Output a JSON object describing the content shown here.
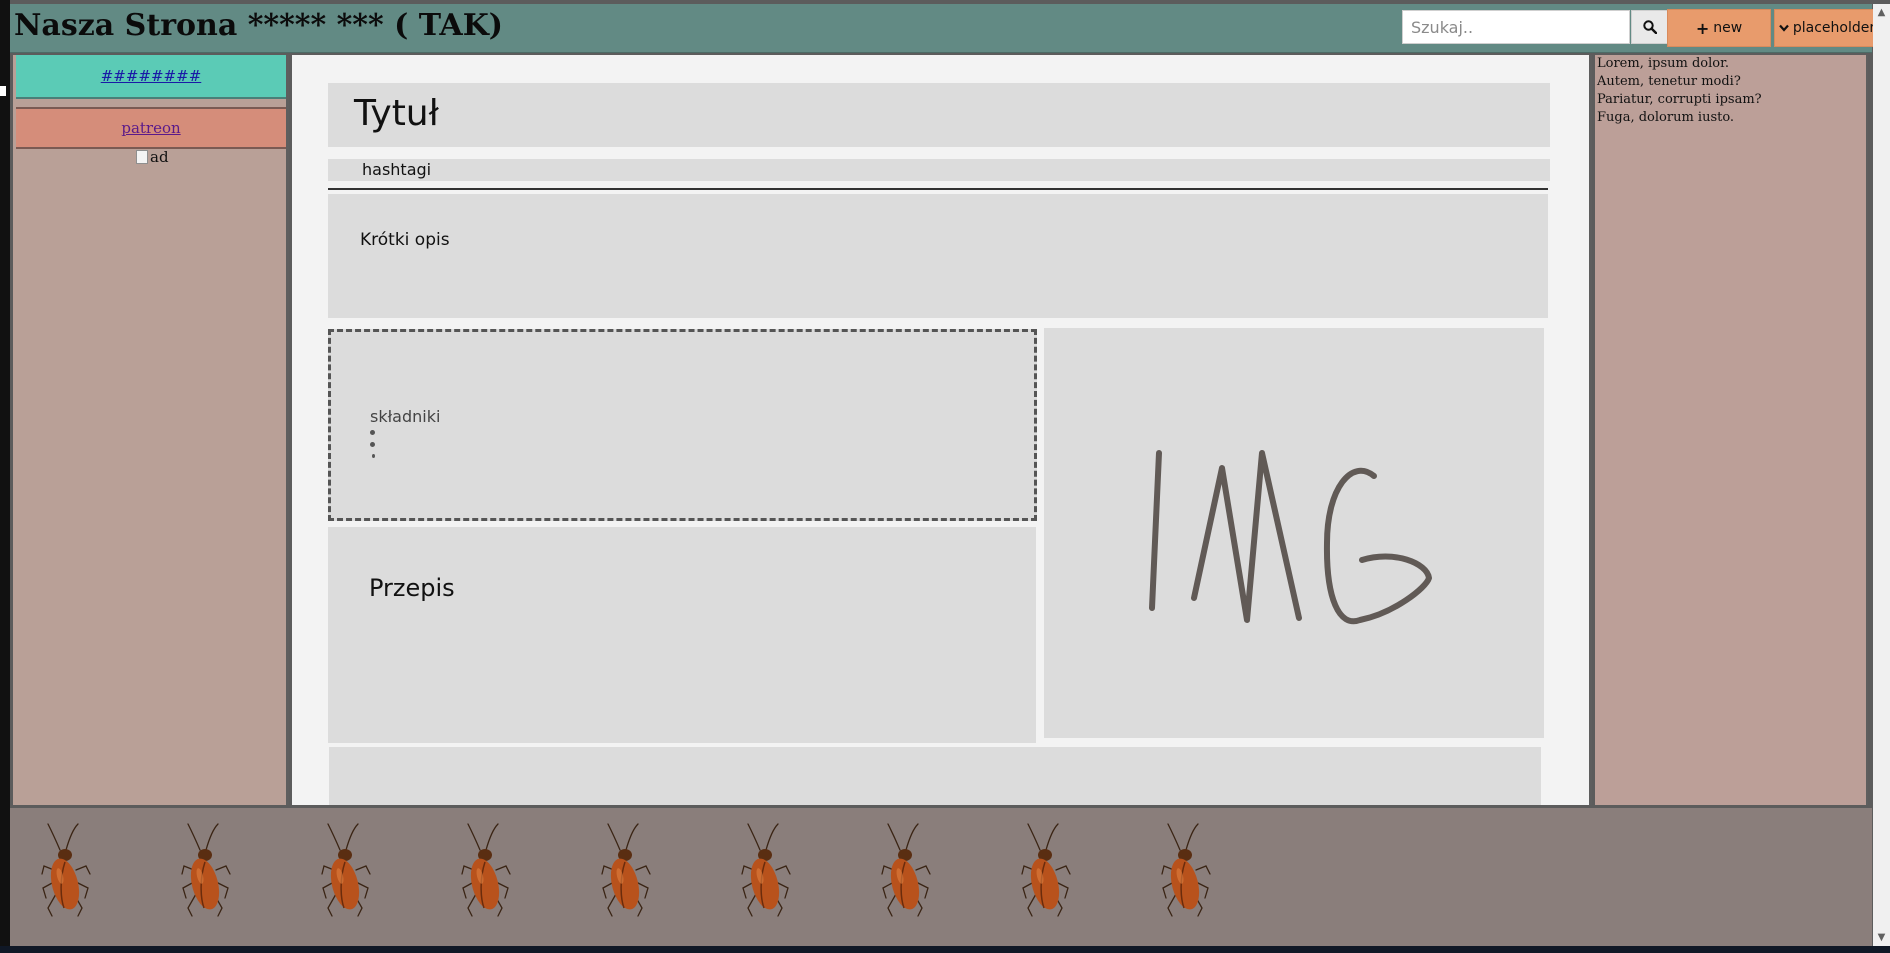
{
  "header": {
    "title": "Nasza Strona ***** *** ( TAK)",
    "search_placeholder": "Szukaj..",
    "new_label": "new",
    "placeholder_label": "placeholder"
  },
  "sidebar_left": {
    "link_top": "########",
    "link_patreon": "patreon",
    "ad_alt": "ad"
  },
  "main": {
    "title": "Tytuł",
    "hashtags": "hashtagi",
    "short_desc": "Krótki opis",
    "ingredients_title": "składniki",
    "recipe_title": "Przepis",
    "image_label": "IMG"
  },
  "sidebar_right": {
    "lines": [
      "Lorem, ipsum dolor.",
      "Autem, tenetur modi?",
      "Pariatur, corrupti ipsam?",
      "Fuga, dolorum iusto."
    ]
  },
  "footer": {
    "roach_count": 9,
    "roach_icon": "cockroach-icon"
  },
  "colors": {
    "header_bg": "#628a84",
    "button_bg": "#e89b6c",
    "sidebar_teal": "#5bcbb6",
    "sidebar_salmon": "#d58d7a",
    "panel_bg": "#b9a097",
    "main_bg": "#f3f3f3",
    "box_bg": "#dcdcdc",
    "footer_bg": "#8a7e7b"
  }
}
